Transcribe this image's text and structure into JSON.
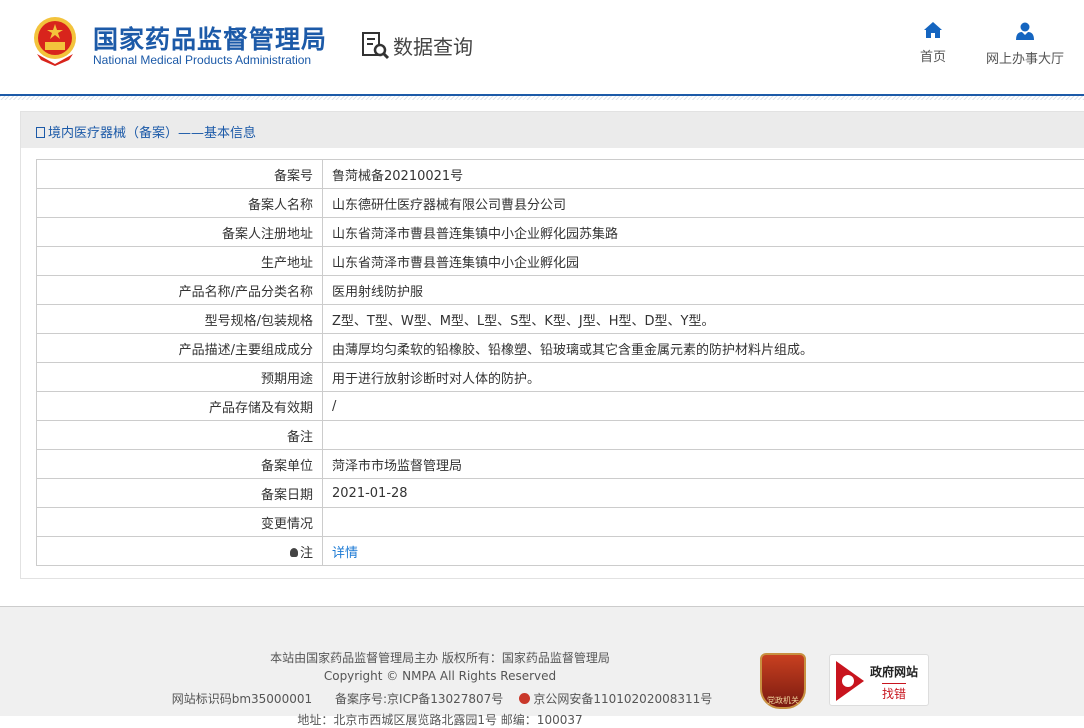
{
  "header": {
    "title_cn": "国家药品监督管理局",
    "title_en": "National Medical Products Administration",
    "data_query": "数据查询",
    "nav": [
      {
        "label": "首页",
        "icon": "home-icon"
      },
      {
        "label": "网上办事大厅",
        "icon": "user-icon"
      }
    ]
  },
  "panel": {
    "title": "境内医疗器械（备案）——基本信息"
  },
  "rows": [
    {
      "label": "备案号",
      "value": "鲁菏械备20210021号"
    },
    {
      "label": "备案人名称",
      "value": "山东德研仕医疗器械有限公司曹县分公司"
    },
    {
      "label": "备案人注册地址",
      "value": "山东省菏泽市曹县普连集镇中小企业孵化园苏集路"
    },
    {
      "label": "生产地址",
      "value": "山东省菏泽市曹县普连集镇中小企业孵化园"
    },
    {
      "label": "产品名称/产品分类名称",
      "value": "医用射线防护服"
    },
    {
      "label": "型号规格/包装规格",
      "value": "Z型、T型、W型、M型、L型、S型、K型、J型、H型、D型、Y型。"
    },
    {
      "label": "产品描述/主要组成成分",
      "value": "由薄厚均匀柔软的铅橡胶、铅橡塑、铅玻璃或其它含重金属元素的防护材料片组成。"
    },
    {
      "label": "预期用途",
      "value": "用于进行放射诊断时对人体的防护。"
    },
    {
      "label": "产品存储及有效期",
      "value": "/"
    },
    {
      "label": "备注",
      "value": ""
    },
    {
      "label": "备案单位",
      "value": "菏泽市市场监督管理局"
    },
    {
      "label": "备案日期",
      "value": "2021-01-28"
    },
    {
      "label": "变更情况",
      "value": ""
    }
  ],
  "note": {
    "label": "注",
    "link": "详情"
  },
  "footer": {
    "line1": "本站由国家药品监督管理局主办 版权所有：国家药品监督管理局",
    "line2": "Copyright © NMPA All Rights Reserved",
    "site_id": "网站标识码bm35000001",
    "icp": "备案序号:京ICP备13027807号",
    "police": "京公网安备11010202008311号",
    "line4": "地址：北京市西城区展览路北露园1号 邮编：100037",
    "badge1": "党政机关",
    "badge2_top": "政府网站",
    "badge2_bottom": "找错"
  }
}
